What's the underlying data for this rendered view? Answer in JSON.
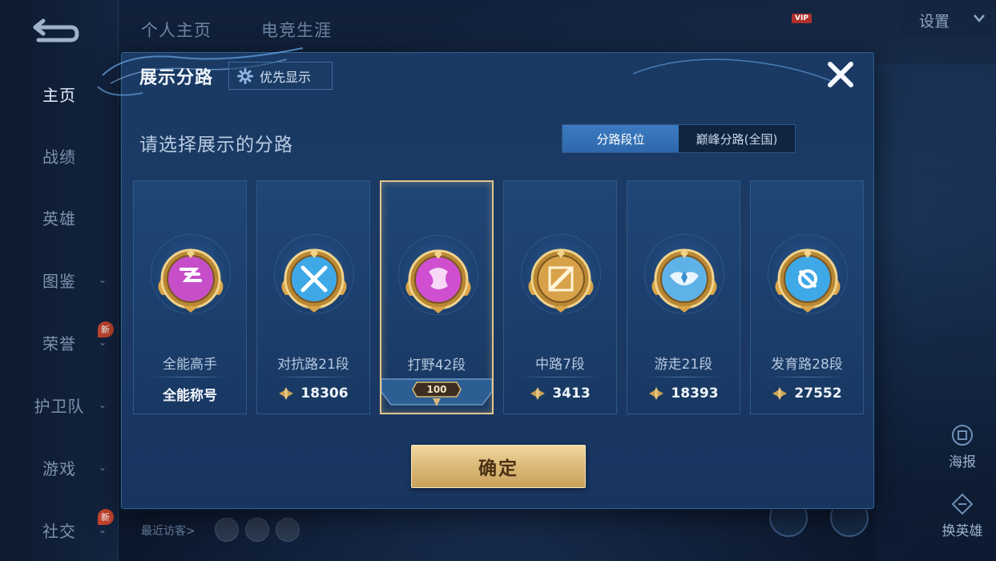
{
  "background": {
    "top_tabs": [
      "个人主页",
      "电竞生涯"
    ],
    "settings_label": "设置",
    "vip_badge": "VIP",
    "vip_info": [
      "",
      ""
    ],
    "nav": [
      {
        "label": "主页",
        "active": true
      },
      {
        "label": "战绩"
      },
      {
        "label": "英雄"
      },
      {
        "label": "图鉴",
        "chevron": true
      },
      {
        "label": "荣誉",
        "chevron": true,
        "badge": "新"
      },
      {
        "label": "护卫队",
        "chevron": true
      },
      {
        "label": "游戏",
        "chevron": true
      },
      {
        "label": "社交",
        "chevron": true,
        "badge": "新"
      }
    ],
    "recent_visitors_label": "最近访客>",
    "right_buttons": [
      "海报",
      "换英雄"
    ]
  },
  "dialog": {
    "title": "展示分路",
    "priority_button": "优先显示",
    "subtitle": "请选择展示的分路",
    "tabs": [
      {
        "label": "分路段位",
        "active": true
      },
      {
        "label": "巅峰分路(全国)",
        "active": false
      }
    ],
    "cards": [
      {
        "name": "全能高手",
        "footer": "全能称号",
        "points": null,
        "selected": false,
        "badge_color": "#c64fc9",
        "badge_icon": "all-round-icon"
      },
      {
        "name": "对抗路21段",
        "footer": null,
        "points": "18306",
        "selected": false,
        "badge_color": "#3fa8e6",
        "badge_icon": "crossed-swords-icon"
      },
      {
        "name": "打野42段",
        "footer": null,
        "points": null,
        "selected": true,
        "selected_number": "100",
        "badge_color": "#cf4fd0",
        "badge_icon": "dragon-icon"
      },
      {
        "name": "中路7段",
        "footer": null,
        "points": "3413",
        "selected": false,
        "badge_color": "#d8a24a",
        "badge_icon": "staff-icon"
      },
      {
        "name": "游走21段",
        "footer": null,
        "points": "18393",
        "selected": false,
        "badge_color": "#5fb2e8",
        "badge_icon": "wings-icon"
      },
      {
        "name": "发育路28段",
        "footer": null,
        "points": "27552",
        "selected": false,
        "badge_color": "#3fa8e6",
        "badge_icon": "shield-arrow-icon"
      }
    ],
    "confirm_button": "确定"
  },
  "colors": {
    "accent_gold": "#ddbb7a",
    "tab_active": "#2e68ab",
    "panel": "#1b3b64"
  }
}
